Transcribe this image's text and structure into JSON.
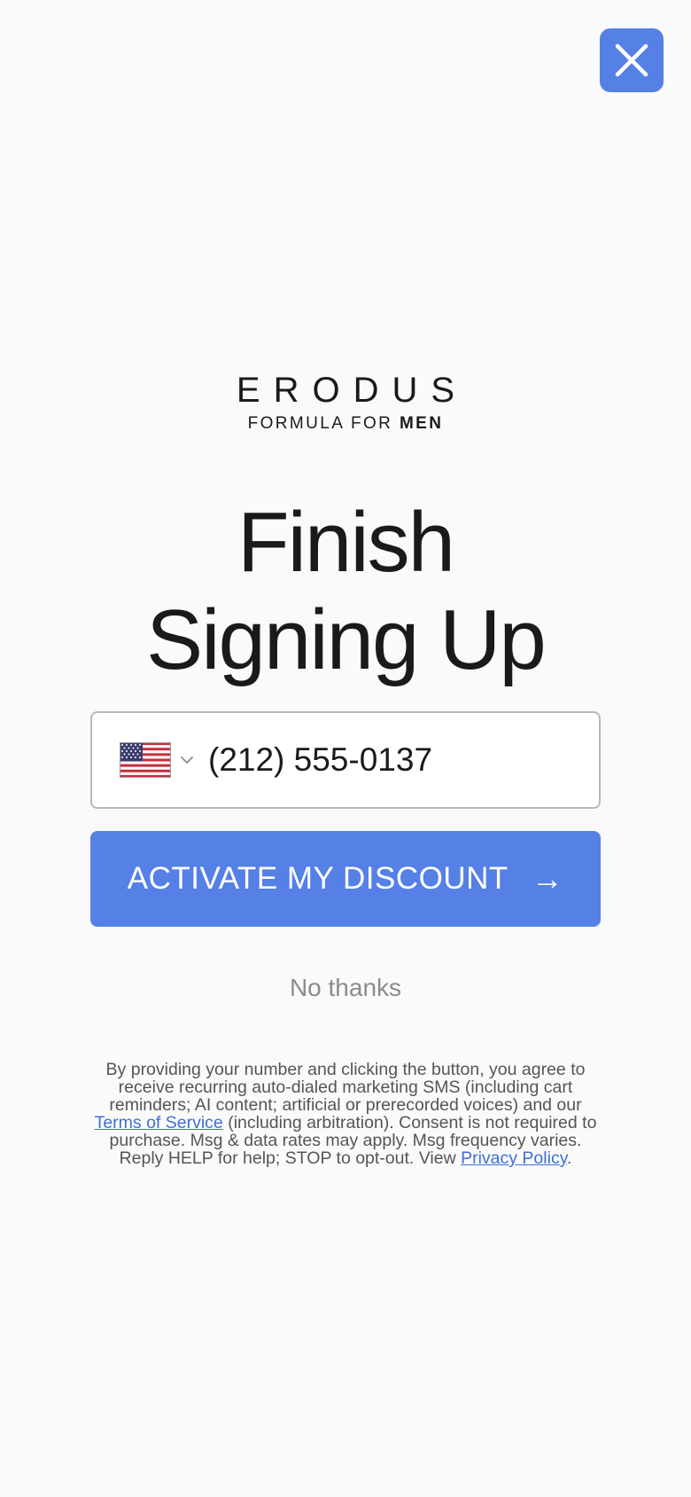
{
  "close": {
    "icon": "close-icon"
  },
  "brand": {
    "name": "ERODUS",
    "tagline_prefix": "FORMULA FOR",
    "tagline_bold": "MEN"
  },
  "headline": {
    "line1": "Finish",
    "line2": "Signing Up"
  },
  "phone": {
    "country_flag": "us-flag-icon",
    "value": "(212) 555-0137"
  },
  "cta": {
    "label": "ACTIVATE MY DISCOUNT",
    "arrow": "→"
  },
  "decline": {
    "label": "No thanks"
  },
  "legal": {
    "text1": "By providing your number and clicking the button, you agree to receive recurring auto-dialed marketing SMS (including cart reminders; AI content; artificial or prerecorded voices) and our ",
    "terms_link": "Terms of Service",
    "text2": " (including arbitration). Consent is not required to purchase. Msg & data rates may apply. Msg frequency varies. Reply HELP for help; STOP to opt-out. View ",
    "privacy_link": "Privacy Policy",
    "text3": "."
  },
  "colors": {
    "accent": "#5580e6",
    "link": "#3e6fd6",
    "muted": "#8c8c8c",
    "background": "#fafafa"
  }
}
